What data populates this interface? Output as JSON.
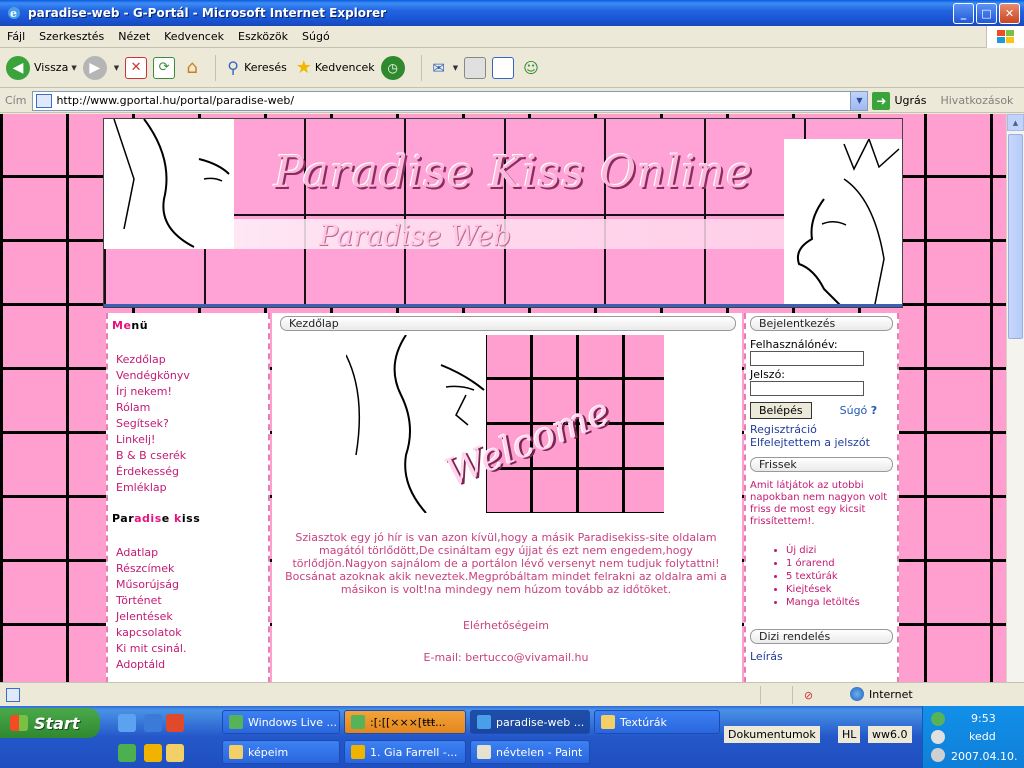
{
  "window": {
    "title": "paradise-web - G-Portál - Microsoft Internet Explorer",
    "minimize": "_",
    "maximize": "□",
    "close": "✕"
  },
  "menubar": [
    "Fájl",
    "Szerkesztés",
    "Nézet",
    "Kedvencek",
    "Eszközök",
    "Súgó"
  ],
  "toolbar": {
    "back": "Vissza",
    "search": "Keresés",
    "favorites": "Kedvencek"
  },
  "address": {
    "label": "Cím",
    "url": "http://www.gportal.hu/portal/paradise-web/",
    "go": "Ugrás",
    "links": "Hivatkozások"
  },
  "banner": {
    "title": "Paradise Kiss Online",
    "subtitle": "Paradise Web"
  },
  "left": {
    "menu_title_hl": "Me",
    "menu_title_rest": "nü",
    "menu_items": [
      "Kezdőlap",
      "Vendégkönyv",
      "Írj nekem!",
      "Rólam",
      "Segítsek?",
      "Linkelj!",
      "B & B cserék",
      "Érdekesség",
      "Emléklap"
    ],
    "pk_title_a": "Par",
    "pk_title_hl": "adis",
    "pk_title_b": "e ",
    "pk_title_c": "k",
    "pk_title_d": "iss",
    "pk_items": [
      "Adatlap",
      "Részcímek",
      "Műsorújság",
      "Történet",
      "Jelentések",
      "kapcsolatok",
      "Ki mit csinál.",
      "Adoptáld"
    ]
  },
  "center": {
    "header": "Kezdőlap",
    "welcome_text": "Welcome",
    "paragraph": "Sziasztok egy jó hír is van azon kívül,hogy a másik Paradisekiss-site oldalam magától törlődött,De csináltam egy újjat és ezt nem engedem,hogy törlődjön.Nagyon sajnálom de a portálon lévő versenyt nem tudjuk folytattni! Bocsánat azoknak akik neveztek.Megpróbáltam mindet felrakni az oldalra ami a másikon is volt!na mindegy nem húzom tovább az időtöket.",
    "contacts": "Elérhetőségeim",
    "email": "E-mail: bertucco@vivamail.hu"
  },
  "right": {
    "login_header": "Bejelentkezés",
    "username_label": "Felhasználónév:",
    "password_label": "Jelszó:",
    "login_button": "Belépés",
    "help": "Súgó",
    "help_mark": "?",
    "register": "Regisztráció",
    "forgot": "Elfelejtettem a jelszót",
    "friss_header": "Frissek",
    "friss_text": "Amit látjátok az utobbi napokban nem nagyon volt friss de most egy kicsit frissítettem!.",
    "friss_items": [
      "Új dizi",
      "1 órarend",
      "5 textúrák",
      "Kiejtések",
      "Manga letöltés"
    ],
    "dizi_header": "Dizi rendelés",
    "dizi_link": "Leírás"
  },
  "statusbar": {
    "zone": "Internet"
  },
  "taskbar": {
    "start": "Start",
    "tasks": [
      {
        "label": "Windows Live ..."
      },
      {
        "label": ":[:[[×××[ŧŧŧ..."
      },
      {
        "label": "paradise-web ..."
      },
      {
        "label": "Textúrák"
      },
      {
        "label": "képeim"
      },
      {
        "label": "1. Gia Farrell -..."
      },
      {
        "label": "névtelen - Paint"
      }
    ],
    "deskbar": "Dokumentumok",
    "lang": "HL",
    "ww": "ww6.0",
    "time": "9:53",
    "day": "kedd",
    "date": "2007.04.10."
  },
  "colors": {
    "page_pink": "#ff9fd0",
    "menu_link": "#c31a72",
    "xp_blue": "#2265e0"
  }
}
